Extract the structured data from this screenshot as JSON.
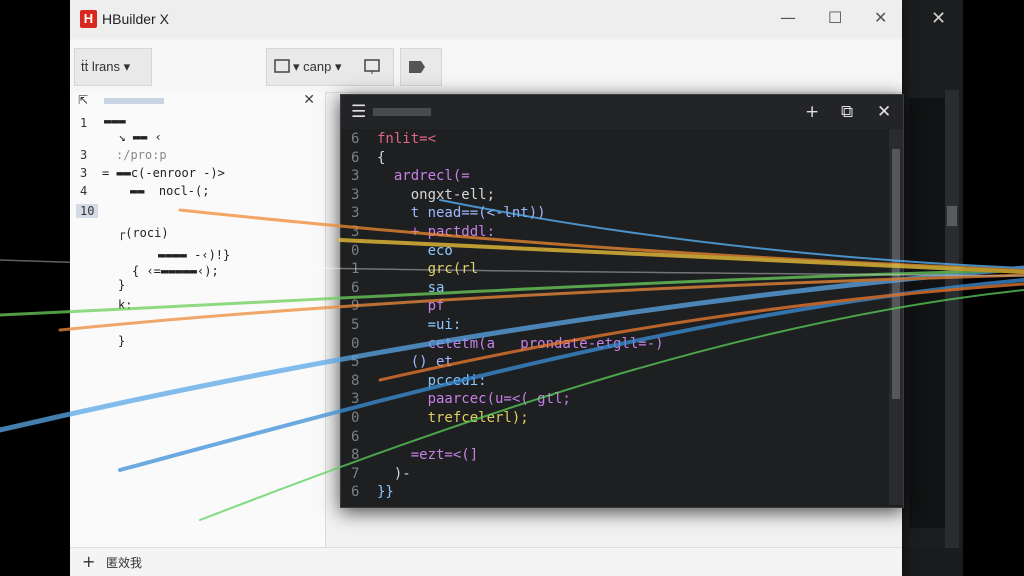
{
  "app": {
    "logo_letter": "H",
    "title": "HBuilder X"
  },
  "window": {
    "minimize": "—",
    "maximize": "☐",
    "close": "✕"
  },
  "back_window": {
    "close": "✕"
  },
  "toolbar": {
    "left_label": "ṫṫ lrans ▾",
    "mid_label": "▾ canp ▾"
  },
  "sidebar": {
    "close": "✕",
    "line_numbers": [
      "1",
      "3",
      "3",
      "4",
      "10"
    ],
    "lines": [
      "▬▬▬",
      "  ↘ ▬▬ ‹",
      ":/pro:p",
      "= ▬▬c(-enroor -)>",
      "▬▬  nocl-(;",
      "┌(roci)",
      "▬▬▬▬ -‹)!}",
      "{ ‹=▬▬▬▬▬‹);",
      "}",
      "k:",
      "}"
    ]
  },
  "editor": {
    "menu_icon": "☰",
    "add_icon": "+",
    "popout_icon": "⧉",
    "close_icon": "✕",
    "rows": [
      {
        "ln": "6",
        "code": "fnlit=<",
        "color": "#e0658a"
      },
      {
        "ln": "6",
        "code": "{",
        "color": "#d6d6d6"
      },
      {
        "ln": "3",
        "code": "  ardrecl(=",
        "color": "#c880e8"
      },
      {
        "ln": "3",
        "code": "    ongxt-ell;",
        "color": "#d8d8d8"
      },
      {
        "ln": "3",
        "code": "    t nead==(<-lnt))",
        "color": "#9fb8ff"
      },
      {
        "ln": "3",
        "code": "    + pactddl:",
        "color": "#c880e8"
      },
      {
        "ln": "0",
        "code": "      eco",
        "color": "#8ac8ff"
      },
      {
        "ln": "1",
        "code": "      grc(rl",
        "color": "#e0d060"
      },
      {
        "ln": "6",
        "code": "      sa",
        "color": "#8ac8ff"
      },
      {
        "ln": "9",
        "code": "      pf",
        "color": "#c880e8"
      },
      {
        "ln": "5",
        "code": "      =ui:",
        "color": "#8ac8ff"
      },
      {
        "ln": "0",
        "code": "      cetetm(a   prondate-etgll=-)",
        "color": "#c880e8"
      },
      {
        "ln": "5",
        "code": "    () et",
        "color": "#9fb8ff"
      },
      {
        "ln": "8",
        "code": "      pccedi:",
        "color": "#8ac8ff"
      },
      {
        "ln": "3",
        "code": "      paarcec(u=<( gtl;",
        "color": "#c880e8"
      },
      {
        "ln": "0",
        "code": "      trefcelerl);",
        "color": "#e0d060"
      },
      {
        "ln": "6",
        "code": "",
        "color": "#d6d6d6"
      },
      {
        "ln": "8",
        "code": "    =ezt=<(]",
        "color": "#c880e8"
      },
      {
        "ln": "7",
        "code": "  )-",
        "color": "#d6d6d6"
      },
      {
        "ln": "6",
        "code": "}}",
        "color": "#8ac8ff"
      }
    ]
  },
  "statusbar": {
    "add": "+",
    "text": "匿效我"
  },
  "colors": {
    "accent_red": "#d8281f",
    "editor_bg": "#1e1f21",
    "window_bg": "#f2f2f2"
  }
}
